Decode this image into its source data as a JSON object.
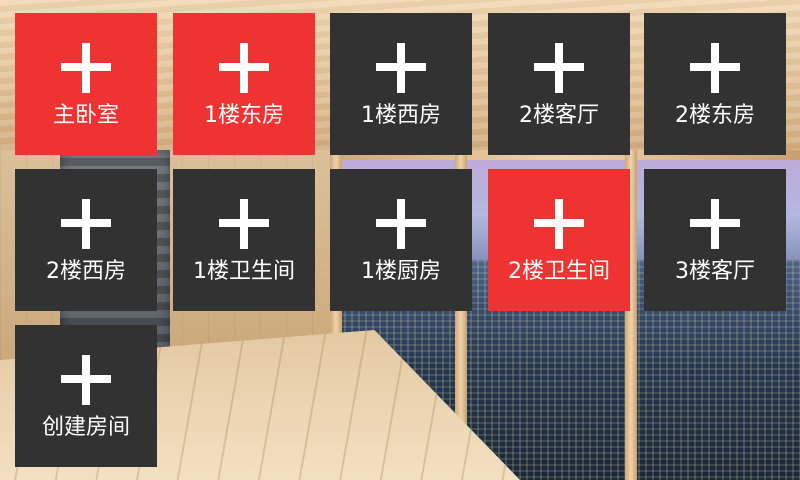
{
  "colors": {
    "tile_default": "#323232",
    "tile_active": "#ef3232",
    "text": "#ffffff"
  },
  "tiles": [
    {
      "label": "主卧室",
      "icon": "plus-icon",
      "active": true
    },
    {
      "label": "1楼东房",
      "icon": "plus-icon",
      "active": true
    },
    {
      "label": "1楼西房",
      "icon": "plus-icon",
      "active": false
    },
    {
      "label": "2楼客厅",
      "icon": "plus-icon",
      "active": false
    },
    {
      "label": "2楼东房",
      "icon": "plus-icon",
      "active": false
    },
    {
      "label": "2楼西房",
      "icon": "plus-icon",
      "active": false
    },
    {
      "label": "1楼卫生间",
      "icon": "plus-icon",
      "active": false
    },
    {
      "label": "1楼厨房",
      "icon": "plus-icon",
      "active": false
    },
    {
      "label": "2楼卫生间",
      "icon": "plus-icon",
      "active": true
    },
    {
      "label": "3楼客厅",
      "icon": "plus-icon",
      "active": false
    },
    {
      "label": "创建房间",
      "icon": "plus-icon",
      "active": false
    }
  ]
}
